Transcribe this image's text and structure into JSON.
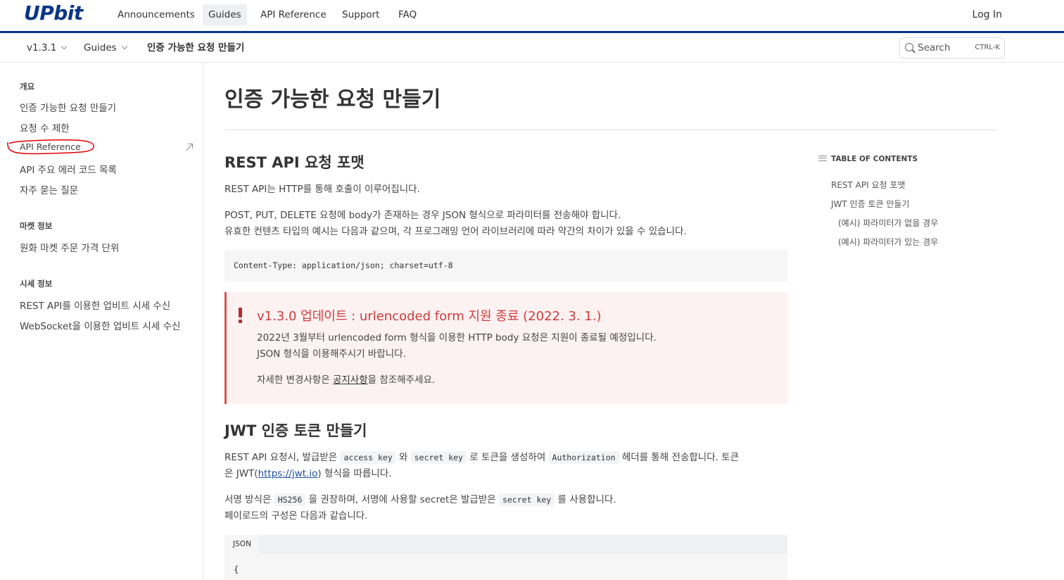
{
  "brand": {
    "logo": "UPbit",
    "accent": "#093687"
  },
  "topnav": {
    "items": [
      {
        "label": "Announcements"
      },
      {
        "label": "Guides",
        "active": true
      },
      {
        "label": "API Reference"
      },
      {
        "label": "Support"
      },
      {
        "label": "FAQ"
      }
    ],
    "login": "Log In"
  },
  "subbar": {
    "version": "v1.3.1",
    "section": "Guides",
    "current_page": "인증 가능한 요청 만들기",
    "search": {
      "label": "Search",
      "shortcut": "CTRL-K"
    }
  },
  "sidebar": {
    "groups": [
      {
        "heading": "개요",
        "items": [
          "인증 가능한 요청 만들기",
          "요청 수 제한",
          "API Reference",
          "API 주요 에러 코드 목록",
          "자주 묻는 질문"
        ]
      },
      {
        "heading": "마켓 정보",
        "items": [
          "원화 마켓 주문 가격 단위"
        ]
      },
      {
        "heading": "시세 정보",
        "items": [
          "REST API를 이용한 업비트 시세 수신",
          "WebSocket을 이용한 업비트 시세 수신"
        ]
      }
    ]
  },
  "content": {
    "title": "인증 가능한 요청 만들기",
    "rest_section": {
      "heading": "REST API 요청 포맷",
      "p1": "REST API는 HTTP를 통해 호출이 이루어집니다.",
      "p2_line1": "POST, PUT, DELETE 요청에 body가 존재하는 경우 JSON 형식으로 파라미터를 전송해야 합니다.",
      "p2_line2": "유효한 컨텐츠 타입의 예시는 다음과 같으며, 각 프로그래밍 언어 라이브러리에 따라 약간의 차이가 있을 수 있습니다.",
      "code": "Content-Type: application/json; charset=utf-8"
    },
    "warning": {
      "title": "v1.3.0 업데이트 : urlencoded form 지원 종료 (2022. 3. 1.)",
      "line1": "2022년 3월부터 urlencoded form 형식을 이용한 HTTP body 요청은 지원이 종료될 예정입니다.",
      "line2": "JSON 형식을 이용해주시기 바랍니다.",
      "line3_pre": "자세한 변경사항은 ",
      "line3_link": "공지사항",
      "line3_post": "을 참조해주세요."
    },
    "jwt_section": {
      "heading": "JWT 인증 토큰 만들기",
      "p1_a": "REST API 요청시, 발급받은 ",
      "code_access": "access key",
      "p1_b": " 와 ",
      "code_secret": "secret key",
      "p1_c": " 로 토큰을 생성하여 ",
      "code_auth": "Authorization",
      "p1_d": " 헤더를 통해 전송합니다. 토큰",
      "p1_line2_a": "은 JWT(",
      "p1_link": "https://jwt.io",
      "p1_line2_b": ") 형식을 따릅니다.",
      "p2_a": "서명 방식은 ",
      "code_hs": "HS256",
      "p2_b": " 을 권장하며, 서명에 사용할 secret은 발급받은 ",
      "code_secret2": "secret key",
      "p2_c": " 를 사용합니다.",
      "p3": "페이로드의 구성은 다음과 같습니다.",
      "json_tab": "JSON",
      "json_first": "{"
    }
  },
  "toc": {
    "heading": "TABLE OF CONTENTS",
    "items": [
      "REST API 요청 포맷",
      "JWT 인증 토큰 만들기",
      "(예시) 파라미터가 없을 경우",
      "(예시) 파라미터가 있는 경우"
    ]
  },
  "colors": {
    "warning_border": "#d9534f",
    "warning_bg": "#fdf2f2",
    "warning_title": "#d03b3b",
    "annotation": "#e00000"
  }
}
